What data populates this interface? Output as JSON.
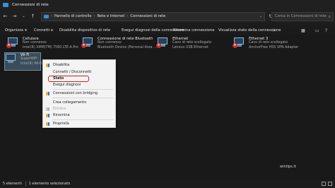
{
  "window": {
    "title": "Connessioni di rete"
  },
  "address": {
    "crumbs": [
      "Pannello di controllo",
      "Rete e Internet",
      "Connessioni di rete"
    ],
    "search_placeholder": "Cerca in Connessioni di rete"
  },
  "toolbar": {
    "items": [
      "Organizza",
      "Connetti a",
      "Disabilita dispositivo di rete",
      "Esegui diagnosi della connessione",
      "Rinomina connessione",
      "Visualizza stato della connessione"
    ]
  },
  "connections": [
    {
      "name": "Cellulare",
      "status": "Non connesso",
      "device": "Intel(R) XMM(TM) 7560 LTE-A Pro",
      "disconnected": true
    },
    {
      "name": "Connessione di rete Bluetooth",
      "status": "Non connesso",
      "device": "Bluetooth Device (Personal Area ...",
      "disconnected": true
    },
    {
      "name": "Ethernet",
      "status": "Cavo di rete scollegato",
      "device": "Lenovo USB Ethernet",
      "disconnected": true
    },
    {
      "name": "Ethernet 3",
      "status": "Cavo di rete scollegato",
      "device": "AnchorFree HSS VPN Adapter",
      "disconnected": true
    },
    {
      "name": "Wi-Fi",
      "status": "SuperWiFi",
      "device": "Intel(R) Wi-Fi",
      "disconnected": false
    }
  ],
  "context_menu": {
    "items": [
      {
        "label": "Disabilita",
        "shield": true,
        "disabled": false,
        "bold": false
      },
      {
        "label": "Connetti / Disconnetti",
        "shield": false,
        "disabled": false,
        "bold": false
      },
      {
        "label": "Stato",
        "shield": false,
        "disabled": false,
        "bold": true
      },
      {
        "label": "Esegui diagnosi",
        "shield": false,
        "disabled": false,
        "bold": false
      },
      {
        "label": "Connessioni con bridging",
        "shield": true,
        "disabled": false,
        "bold": false
      },
      {
        "label": "Crea collegamento",
        "shield": false,
        "disabled": false,
        "bold": false
      },
      {
        "label": "Elimina",
        "shield": true,
        "disabled": true,
        "bold": false
      },
      {
        "label": "Rinomina",
        "shield": true,
        "disabled": false,
        "bold": false
      },
      {
        "label": "Proprietà",
        "shield": true,
        "disabled": false,
        "bold": false
      }
    ]
  },
  "status_bar": {
    "count": "5 elementi",
    "selected": "1 elemento selezionato"
  },
  "watermark": "wintips.it",
  "colors": {
    "background": "#191919",
    "menu_bg": "#f3f3f3",
    "highlight": "#d22020",
    "disconnected_badge": "#d12a2a"
  }
}
